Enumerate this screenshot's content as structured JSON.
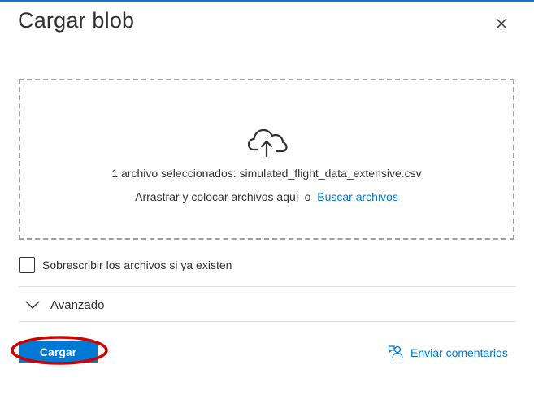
{
  "dialog": {
    "title": "Cargar blob"
  },
  "dropzone": {
    "selected_text": "1 archivo seleccionados: simulated_flight_data_extensive.csv",
    "drag_text": "Arrastrar y colocar archivos aquí",
    "or_text": "o",
    "browse_link": "Buscar archivos"
  },
  "options": {
    "overwrite_label": "Sobrescribir los archivos si ya existen",
    "overwrite_checked": false
  },
  "advanced": {
    "label": "Avanzado"
  },
  "footer": {
    "upload_label": "Cargar",
    "feedback_label": "Enviar comentarios"
  },
  "colors": {
    "accent": "#0078d4",
    "highlight": "#d00000"
  },
  "icons": [
    "close-icon",
    "cloud-upload-icon",
    "chevron-down-icon",
    "feedback-icon"
  ]
}
